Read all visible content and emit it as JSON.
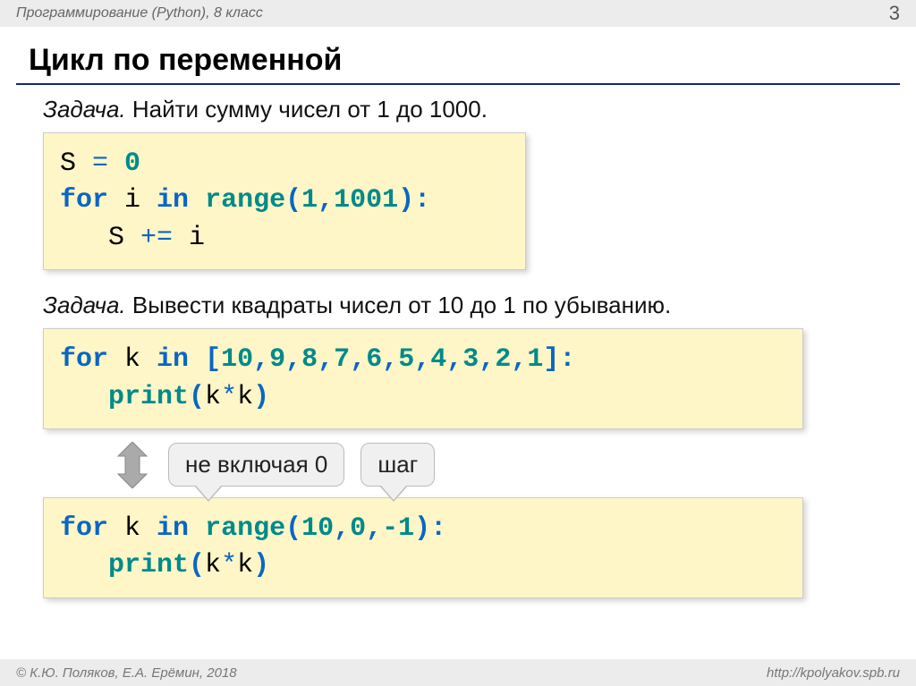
{
  "header": {
    "course": "Программирование (Python), 8 класс",
    "page": "3"
  },
  "title": "Цикл по переменной",
  "task1": {
    "label": "Задача.",
    "text": " Найти сумму чисел от 1 до 1000."
  },
  "code1": {
    "l1a": "S ",
    "l1b": "=",
    "l1c": " ",
    "l1d": "0",
    "l2a": "for",
    "l2b": " i ",
    "l2c": "in",
    "l2d": " ",
    "l2e": "range",
    "l2f": "(",
    "l2g": "1",
    "l2h": ",",
    "l2i": "1001",
    "l2j": "):",
    "l3a": "   S ",
    "l3b": "+=",
    "l3c": " i"
  },
  "task2": {
    "label": "Задача.",
    "text": " Вывести квадраты чисел от 10 до 1 по убыванию."
  },
  "code2": {
    "l1a": "for",
    "l1b": " k ",
    "l1c": "in",
    "l1d": " ",
    "l1e": "[",
    "l1f": "10",
    "l1g": ",",
    "l1h": "9",
    "l1i": ",",
    "l1j": "8",
    "l1k": ",",
    "l1l": "7",
    "l1m": ",",
    "l1n": "6",
    "l1o": ",",
    "l1p": "5",
    "l1q": ",",
    "l1r": "4",
    "l1s": ",",
    "l1t": "3",
    "l1u": ",",
    "l1v": "2",
    "l1w": ",",
    "l1x": "1",
    "l1y": "]:",
    "l2a": "   ",
    "l2b": "print",
    "l2c": "(",
    "l2d": "k",
    "l2e": "*",
    "l2f": "k",
    "l2g": ")"
  },
  "callouts": {
    "c1": "не включая 0",
    "c2": "шаг"
  },
  "code3": {
    "l1a": "for",
    "l1b": " k ",
    "l1c": "in",
    "l1d": " ",
    "l1e": "range",
    "l1f": "(",
    "l1g": "10",
    "l1h": ",",
    "l1i": "0",
    "l1j": ",",
    "l1k": "-1",
    "l1l": "):",
    "l2a": "   ",
    "l2b": "print",
    "l2c": "(",
    "l2d": "k",
    "l2e": "*",
    "l2f": "k",
    "l2g": ")"
  },
  "footer": {
    "copy": "© К.Ю. Поляков, Е.А. Ерёмин, 2018",
    "site": "http://kpolyakov.spb.ru"
  }
}
